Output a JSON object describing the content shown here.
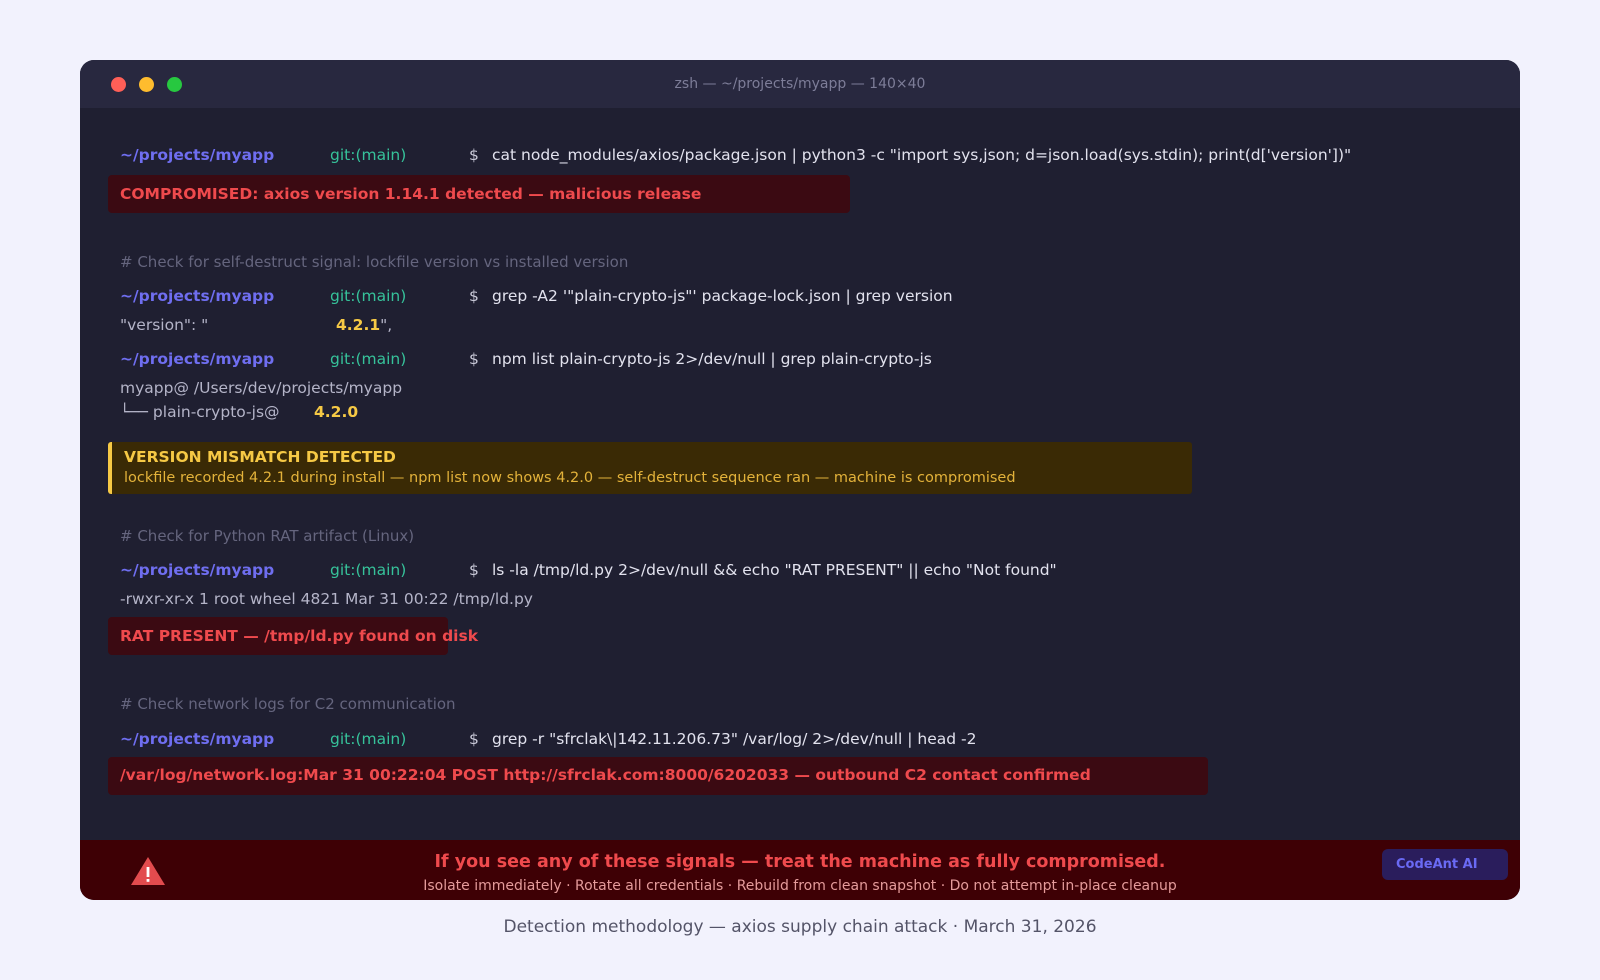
{
  "window": {
    "title": "zsh — ~/projects/myapp — 140×40"
  },
  "prompt": {
    "path": "~/projects/myapp",
    "git": "git:(main)",
    "symbol": "$"
  },
  "blocks": {
    "cmd1": "cat node_modules/axios/package.json | python3 -c \"import sys,json; d=json.load(sys.stdin); print(d['version'])\"",
    "err1": "COMPROMISED: axios version 1.14.1 detected — malicious release",
    "comment1": "# Check for self-destruct signal: lockfile version vs installed version",
    "cmd2": "grep -A2 '\"plain-crypto-js\"' package-lock.json | grep version",
    "out2_prefix": "\"version\": \"",
    "out2_version": "4.2.1",
    "out2_suffix": "\",",
    "cmd3": "npm list plain-crypto-js 2>/dev/null | grep plain-crypto-js",
    "out3_line1": "myapp@ /Users/dev/projects/myapp",
    "out3_line2_prefix": "└── plain-crypto-js@",
    "out3_line2_version": "4.2.0",
    "warn_title": "VERSION MISMATCH DETECTED",
    "warn_detail": "lockfile recorded 4.2.1 during install — npm list now shows 4.2.0 — self-destruct sequence ran — machine is compromised",
    "comment2": "# Check for Python RAT artifact (Linux)",
    "cmd4": "ls -la /tmp/ld.py 2>/dev/null && echo \"RAT PRESENT\" || echo \"Not found\"",
    "out4": "-rwxr-xr-x 1 root wheel 4821 Mar 31 00:22 /tmp/ld.py",
    "err2": "RAT PRESENT — /tmp/ld.py found on disk",
    "comment3": "# Check network logs for C2 communication",
    "cmd5": "grep -r \"sfrclak\\|142.11.206.73\" /var/log/ 2>/dev/null | head -2",
    "err3": "/var/log/network.log:Mar 31 00:22:04 POST http://sfrclak.com:8000/6202033 — outbound C2 contact confirmed"
  },
  "footer": {
    "icon": "warning-icon",
    "main": "If you see any of these signals — treat the machine as fully compromised.",
    "sub": "Isolate immediately · Rotate all credentials · Rebuild from clean snapshot · Do not attempt in-place cleanup",
    "badge": "CodeAnt AI"
  },
  "caption": "Detection methodology — axios supply chain attack · March 31, 2026",
  "colors": {
    "background": "#f2f2fd",
    "terminal": "#1f1f31",
    "prompt_path": "#6f6ef0",
    "prompt_git": "#36c29a",
    "error": "#ef4a4d",
    "warning": "#f6c945"
  }
}
